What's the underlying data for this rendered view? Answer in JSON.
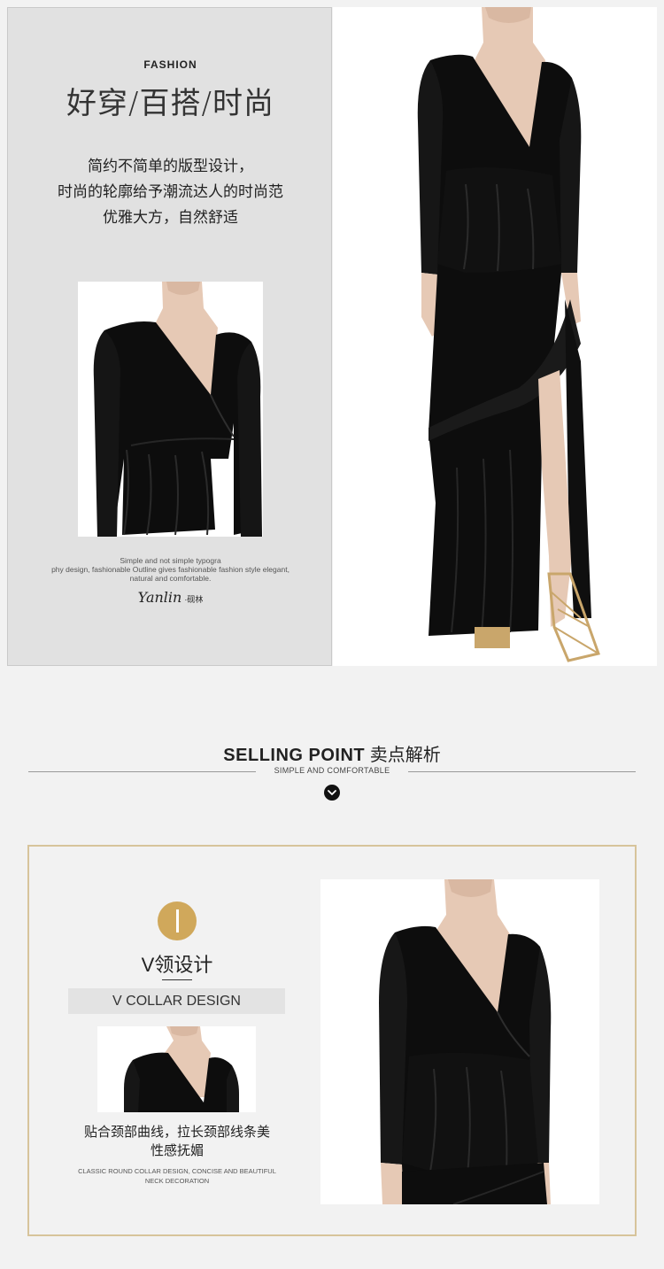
{
  "hero": {
    "kicker": "FASHION",
    "headline": "好穿/百搭/时尚",
    "intro_lines": [
      "简约不简单的版型设计，",
      "时尚的轮廓给予潮流达人的时尚范",
      "优雅大方，自然舒适"
    ],
    "caption_en_lines": [
      "Simple and not simple typogra",
      "phy design, fashionable Outline gives fashionable fashion style elegant,",
      "natural and comfortable."
    ],
    "brand_logo": "Yanlin",
    "brand_cn": "·砚林"
  },
  "selling_point": {
    "title_en": "SELLING POINT",
    "title_cn": "卖点解析",
    "subtitle": "SIMPLE AND COMFORTABLE",
    "arrow_icon": "chevron-down-icon"
  },
  "feature": {
    "badge": "I",
    "title": "V领设计",
    "band": "V COLLAR DESIGN",
    "desc_lines": [
      "贴合颈部曲线，拉长颈部线条美",
      "性感抚媚"
    ],
    "desc_en_lines": [
      "CLASSIC ROUND COLLAR DESIGN, CONCISE AND BEAUTIFUL",
      "NECK DECORATION"
    ]
  },
  "colors": {
    "page_bg": "#f2f2f2",
    "panel_bg": "#e1e1e1",
    "accent_gold": "#d0a85b",
    "card_border": "#d7c49b",
    "dress": "#0d0d0d",
    "skin": "#e6c9b5"
  }
}
